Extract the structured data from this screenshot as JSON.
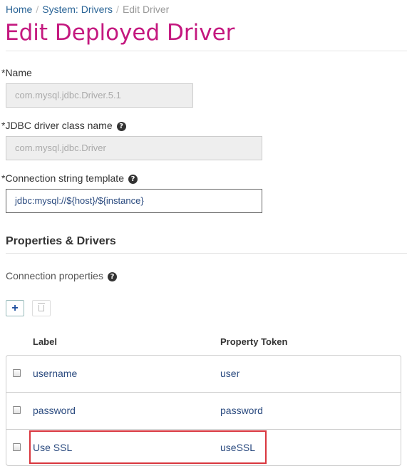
{
  "breadcrumb": {
    "home": "Home",
    "separator": "/",
    "drivers": "System: Drivers",
    "current": "Edit Driver"
  },
  "page_title": "Edit Deployed Driver",
  "form": {
    "name_label": "*Name",
    "name_value": "com.mysql.jdbc.Driver.5.1",
    "class_label": "*JDBC driver class name",
    "class_value": "com.mysql.jdbc.Driver",
    "conn_label": "*Connection string template",
    "conn_value": "jdbc:mysql://${host}/${instance}"
  },
  "properties": {
    "section_title": "Properties & Drivers",
    "conn_props_label": "Connection properties",
    "add_label": "+",
    "columns": {
      "label": "Label",
      "token": "Property Token"
    },
    "rows": [
      {
        "label": "username",
        "token": "user",
        "checked": false
      },
      {
        "label": "password",
        "token": "password",
        "checked": false
      },
      {
        "label": "Use SSL",
        "token": "useSSL",
        "checked": false
      }
    ]
  },
  "colors": {
    "title": "#c4187f",
    "link": "#2a6496",
    "highlight": "#d9363e"
  },
  "icons": {
    "help": "question-circle-icon",
    "add": "plus-icon",
    "delete": "trash-icon"
  }
}
